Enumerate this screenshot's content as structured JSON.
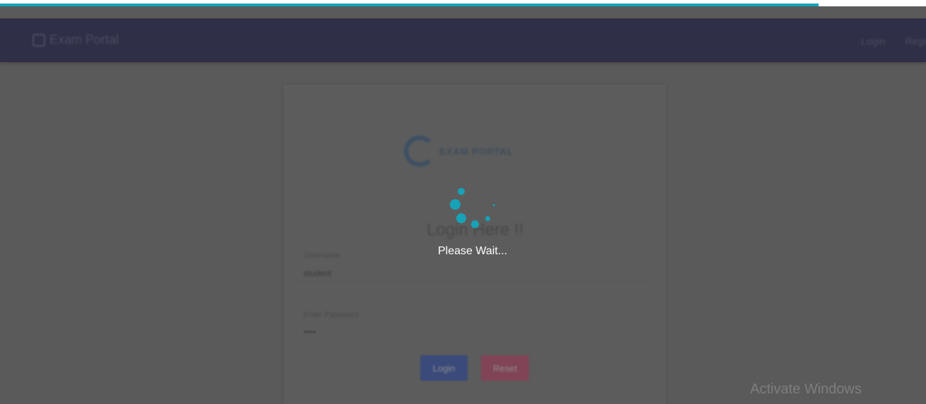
{
  "progress": {
    "value_percent": 88.4,
    "color": "#17a2b8"
  },
  "navbar": {
    "brand": "Exam Portal",
    "links": [
      "Login",
      "Regist"
    ]
  },
  "logo": {
    "title": "EXAM PORTAL",
    "subtitle": ""
  },
  "card": {
    "heading": "Login Here !!",
    "username_label": "Username",
    "username_value": "student",
    "password_hint": "",
    "password_label": "Enter Password",
    "password_value": "••••",
    "login_button": "Login",
    "reset_button": "Reset"
  },
  "overlay": {
    "message": "Please Wait..."
  },
  "os": {
    "watermark": "Activate Windows"
  }
}
